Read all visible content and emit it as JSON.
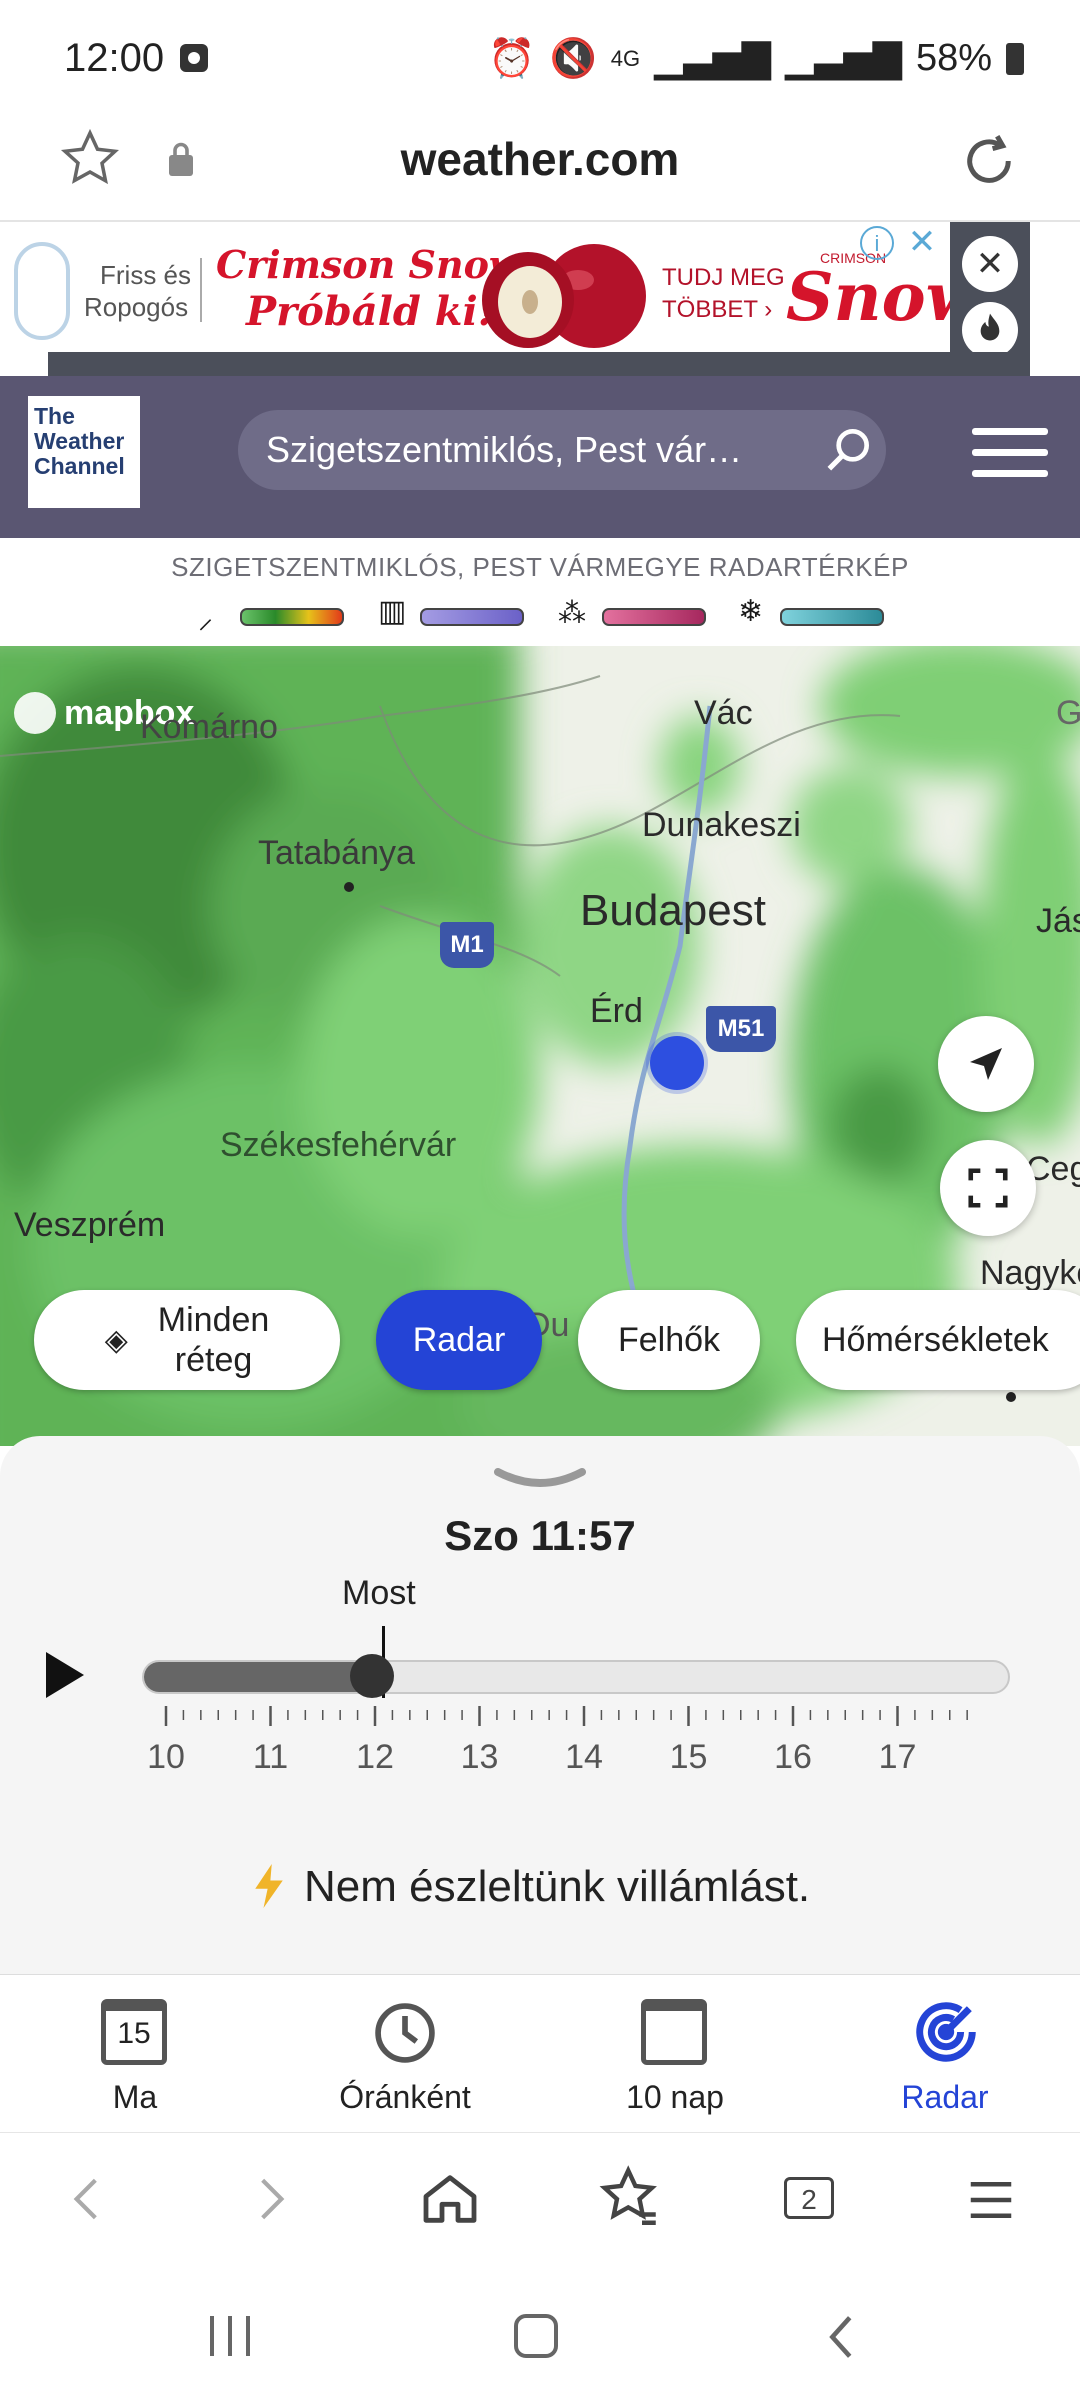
{
  "status_bar": {
    "time": "12:00",
    "network": "4G",
    "battery": "58%"
  },
  "browser": {
    "url": "weather.com"
  },
  "ad": {
    "line1": "Friss és",
    "line2": "Ropogós",
    "headline1": "Crimson Snow",
    "headline2": "Próbáld ki!",
    "cta1": "TUDJ MEG",
    "cta2": "TÖBBET ›",
    "brand": "Snow",
    "brand_small": "CRIMSON"
  },
  "header": {
    "logo_line1": "The",
    "logo_line2": "Weather",
    "logo_line3": "Channel",
    "search_value": "Szigetszentmiklós, Pest vár…"
  },
  "legend": {
    "title": "SZIGETSZENTMIKLÓS, PEST VÁRMEGYE RADARTÉRKÉP",
    "colors": {
      "rain": "#3aa63a",
      "freezing": "#8a82d6",
      "mix": "#c13c7c",
      "snow": "#3fa8b6"
    }
  },
  "map": {
    "attribution": "mapbox",
    "cities": {
      "vac": "Vác",
      "dunakeszi": "Dunakeszi",
      "budapest": "Budapest",
      "erd": "Érd",
      "tatabanya": "Tatabánya",
      "komarom": "Komárno",
      "szekesfehervar": "Székesfehérvár",
      "veszprem": "Veszprém",
      "nagykoros": "Nagykő",
      "jaszbereny": "Jás",
      "cegled": "Cegl",
      "g": "G",
      "du": "Du"
    },
    "roads": {
      "m1": "M1",
      "m51": "M51"
    },
    "layer_chips": {
      "all_line1": "Minden",
      "all_line2": "réteg",
      "radar": "Radar",
      "clouds": "Felhők",
      "temps": "Hőmérsékletek"
    }
  },
  "timeline": {
    "datetime": "Szo 11:57",
    "now_label": "Most",
    "hours": [
      "10",
      "11",
      "12",
      "13",
      "14",
      "15",
      "16",
      "17"
    ],
    "progress_fraction": 0.265,
    "lightning_text": "Nem észleltünk villámlást."
  },
  "tabs": [
    {
      "label": "Ma",
      "icon": "calendar-day-icon",
      "day": "15"
    },
    {
      "label": "Óránként",
      "icon": "clock-icon"
    },
    {
      "label": "10 nap",
      "icon": "calendar-icon"
    },
    {
      "label": "Radar",
      "icon": "radar-icon",
      "active": true
    }
  ],
  "accent_color": "#2444d6"
}
